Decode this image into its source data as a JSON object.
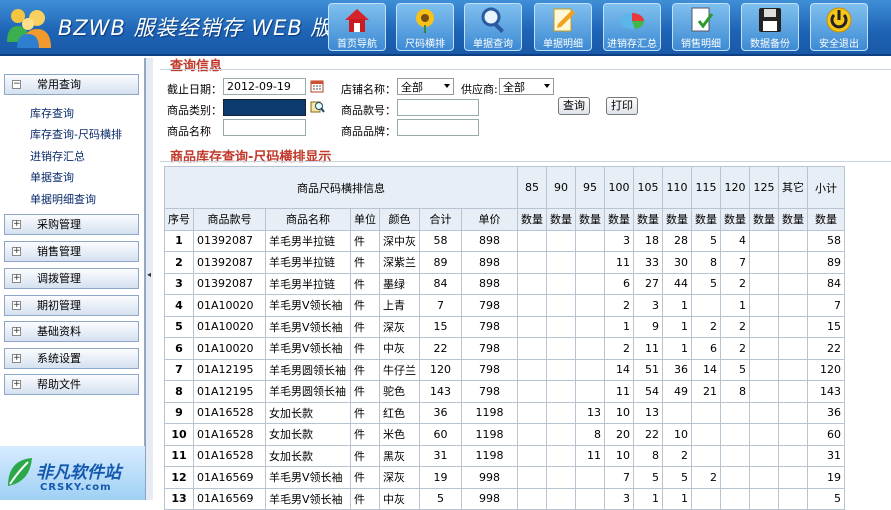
{
  "header": {
    "title": "BZWB 服装经销存 WEB 版",
    "nav": [
      {
        "label": "首页导航",
        "icon": "home-icon"
      },
      {
        "label": "尺码横排",
        "icon": "sunflower-icon"
      },
      {
        "label": "单据查询",
        "icon": "magnifier-icon"
      },
      {
        "label": "单据明细",
        "icon": "edit-document-icon"
      },
      {
        "label": "进销存汇总",
        "icon": "pie-chart-icon"
      },
      {
        "label": "销售明细",
        "icon": "checklist-icon"
      },
      {
        "label": "数据备份",
        "icon": "floppy-disk-icon"
      },
      {
        "label": "安全退出",
        "icon": "power-icon"
      }
    ]
  },
  "sidebar": {
    "groups": [
      {
        "label": "常用查询",
        "expanded": true,
        "items": [
          "库存查询",
          "库存查询-尺码横排",
          "进销存汇总",
          "单据查询",
          "单据明细查询"
        ]
      },
      {
        "label": "采购管理",
        "expanded": false
      },
      {
        "label": "销售管理",
        "expanded": false
      },
      {
        "label": "调拨管理",
        "expanded": false
      },
      {
        "label": "期初管理",
        "expanded": false
      },
      {
        "label": "基础资料",
        "expanded": false
      },
      {
        "label": "系统设置",
        "expanded": false
      },
      {
        "label": "帮助文件",
        "expanded": false
      }
    ],
    "handle_arrow": "◂",
    "watermark": {
      "main": "非凡软件站",
      "sub": "CRSKY.com"
    }
  },
  "query": {
    "title": "查询信息",
    "cutoff_label": "截止日期：",
    "cutoff_value": "2012-09-19",
    "store_label": "店铺名称：",
    "store_value": "全部",
    "supplier_label": "供应商:",
    "supplier_value": "全部",
    "category_label": "商品类别：",
    "category_value": "",
    "code_label": "商品款号：",
    "code_value": "",
    "name_label": "商品名称",
    "name_value": "",
    "brand_label": "商品品牌：",
    "brand_value": "",
    "search_button": "查询",
    "print_button": "打印"
  },
  "results": {
    "title": "商品库存查询-尺码横排显示",
    "group_header": "商品尺码横排信息",
    "sizes": [
      "85",
      "90",
      "95",
      "100",
      "105",
      "110",
      "115",
      "120",
      "125",
      "其它"
    ],
    "subtotal_header": "小计",
    "qty_header": "数量",
    "columns": [
      "序号",
      "商品款号",
      "商品名称",
      "单位",
      "颜色",
      "合计",
      "单价"
    ],
    "rows": [
      {
        "no": "1",
        "code": "01392087",
        "name": "羊毛男半拉链",
        "unit": "件",
        "color": "深中灰",
        "total": "58",
        "price": "898",
        "sizes": [
          "",
          "",
          "",
          "3",
          "18",
          "28",
          "5",
          "4",
          "",
          ""
        ],
        "subtotal": "58"
      },
      {
        "no": "2",
        "code": "01392087",
        "name": "羊毛男半拉链",
        "unit": "件",
        "color": "深紫兰",
        "total": "89",
        "price": "898",
        "sizes": [
          "",
          "",
          "",
          "11",
          "33",
          "30",
          "8",
          "7",
          "",
          ""
        ],
        "subtotal": "89"
      },
      {
        "no": "3",
        "code": "01392087",
        "name": "羊毛男半拉链",
        "unit": "件",
        "color": "墨绿",
        "total": "84",
        "price": "898",
        "sizes": [
          "",
          "",
          "",
          "6",
          "27",
          "44",
          "5",
          "2",
          "",
          ""
        ],
        "subtotal": "84"
      },
      {
        "no": "4",
        "code": "01A10020",
        "name": "羊毛男V领长袖",
        "unit": "件",
        "color": "上青",
        "total": "7",
        "price": "798",
        "sizes": [
          "",
          "",
          "",
          "2",
          "3",
          "1",
          "",
          "1",
          "",
          ""
        ],
        "subtotal": "7"
      },
      {
        "no": "5",
        "code": "01A10020",
        "name": "羊毛男V领长袖",
        "unit": "件",
        "color": "深灰",
        "total": "15",
        "price": "798",
        "sizes": [
          "",
          "",
          "",
          "1",
          "9",
          "1",
          "2",
          "2",
          "",
          ""
        ],
        "subtotal": "15"
      },
      {
        "no": "6",
        "code": "01A10020",
        "name": "羊毛男V领长袖",
        "unit": "件",
        "color": "中灰",
        "total": "22",
        "price": "798",
        "sizes": [
          "",
          "",
          "",
          "2",
          "11",
          "1",
          "6",
          "2",
          "",
          ""
        ],
        "subtotal": "22"
      },
      {
        "no": "7",
        "code": "01A12195",
        "name": "羊毛男圆领长袖",
        "unit": "件",
        "color": "牛仔兰",
        "total": "120",
        "price": "798",
        "sizes": [
          "",
          "",
          "",
          "14",
          "51",
          "36",
          "14",
          "5",
          "",
          ""
        ],
        "subtotal": "120"
      },
      {
        "no": "8",
        "code": "01A12195",
        "name": "羊毛男圆领长袖",
        "unit": "件",
        "color": "驼色",
        "total": "143",
        "price": "798",
        "sizes": [
          "",
          "",
          "",
          "11",
          "54",
          "49",
          "21",
          "8",
          "",
          ""
        ],
        "subtotal": "143"
      },
      {
        "no": "9",
        "code": "01A16528",
        "name": "女加长款",
        "unit": "件",
        "color": "红色",
        "total": "36",
        "price": "1198",
        "sizes": [
          "",
          "",
          "13",
          "10",
          "13",
          "",
          "",
          "",
          "",
          ""
        ],
        "subtotal": "36"
      },
      {
        "no": "10",
        "code": "01A16528",
        "name": "女加长款",
        "unit": "件",
        "color": "米色",
        "total": "60",
        "price": "1198",
        "sizes": [
          "",
          "",
          "8",
          "20",
          "22",
          "10",
          "",
          "",
          "",
          ""
        ],
        "subtotal": "60"
      },
      {
        "no": "11",
        "code": "01A16528",
        "name": "女加长款",
        "unit": "件",
        "color": "黑灰",
        "total": "31",
        "price": "1198",
        "sizes": [
          "",
          "",
          "11",
          "10",
          "8",
          "2",
          "",
          "",
          "",
          ""
        ],
        "subtotal": "31"
      },
      {
        "no": "12",
        "code": "01A16569",
        "name": "羊毛男V领长袖",
        "unit": "件",
        "color": "深灰",
        "total": "19",
        "price": "998",
        "sizes": [
          "",
          "",
          "",
          "7",
          "5",
          "5",
          "2",
          "",
          "",
          ""
        ],
        "subtotal": "19"
      },
      {
        "no": "13",
        "code": "01A16569",
        "name": "羊毛男V领长袖",
        "unit": "件",
        "color": "中灰",
        "total": "5",
        "price": "998",
        "sizes": [
          "",
          "",
          "",
          "3",
          "1",
          "1",
          "",
          "",
          "",
          ""
        ],
        "subtotal": "5"
      }
    ]
  }
}
